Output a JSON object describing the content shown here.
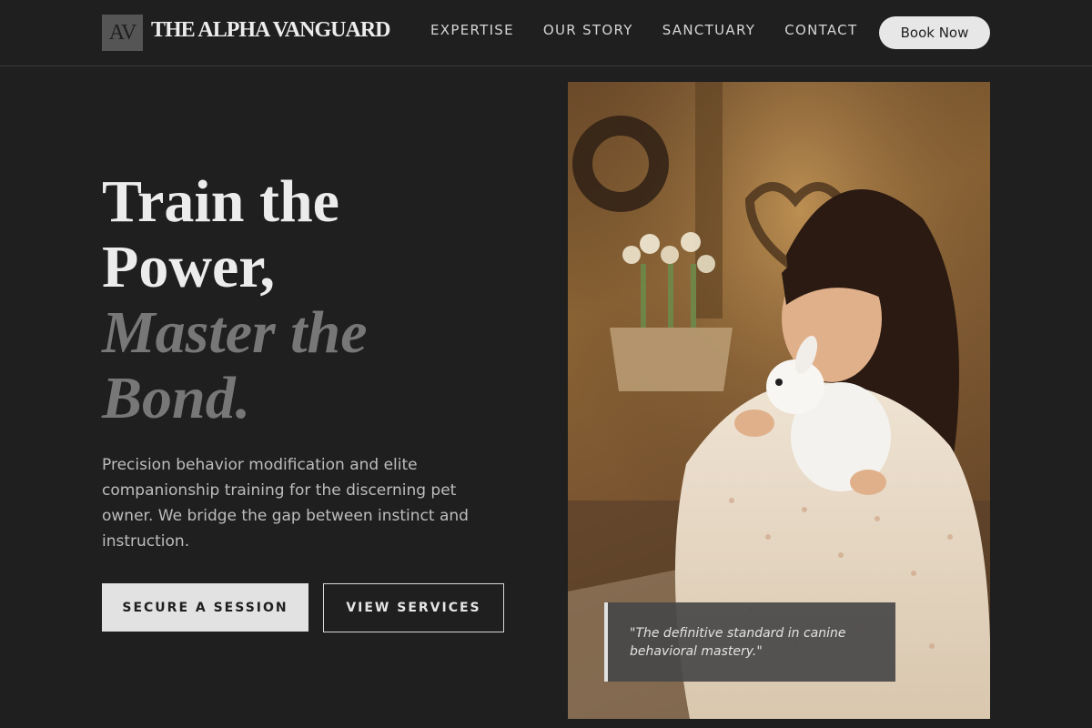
{
  "header": {
    "logo_mark": "AV",
    "brand": "THE ALPHA VANGUARD",
    "nav": [
      {
        "label": "EXPERTISE"
      },
      {
        "label": "OUR STORY"
      },
      {
        "label": "SANCTUARY"
      },
      {
        "label": "CONTACT"
      }
    ],
    "cta": "Book Now"
  },
  "hero": {
    "headline_part1": "Train the Power,",
    "headline_part2": "Master the Bond.",
    "description": "Precision behavior modification and elite companionship training for the discerning pet owner. We bridge the gap between instinct and instruction.",
    "primary_button": "SECURE A SESSION",
    "secondary_button": "VIEW SERVICES",
    "quote": "\"The definitive standard in canine behavioral mastery.\""
  },
  "colors": {
    "background": "#1f1f1f",
    "accent_light": "#e2e2e2",
    "muted_headline": "#777777"
  }
}
